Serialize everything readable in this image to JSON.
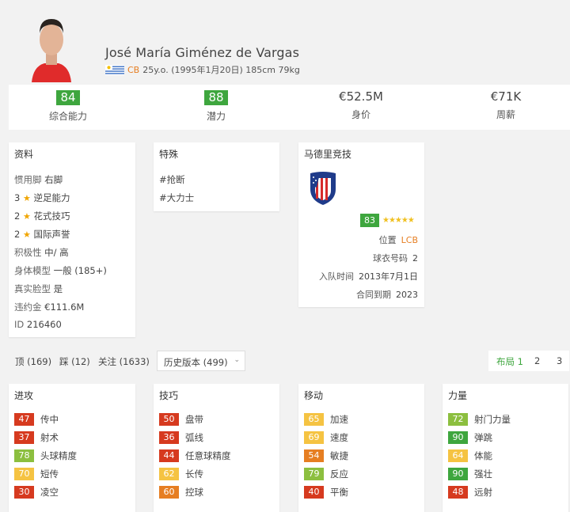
{
  "player": {
    "name": "José María Giménez de Vargas",
    "position": "CB",
    "details": "25y.o. (1995年1月20日) 185cm 79kg"
  },
  "stats": [
    {
      "value": "84",
      "label": "综合能力",
      "badge": true
    },
    {
      "value": "88",
      "label": "潜力",
      "badge": true
    },
    {
      "value": "€52.5M",
      "label": "身价",
      "badge": false
    },
    {
      "value": "€71K",
      "label": "周薪",
      "badge": false
    }
  ],
  "profile": {
    "title": "资料",
    "foot_label": "惯用脚",
    "foot_value": "右脚",
    "weak_foot_num": "3",
    "weak_foot_label": "逆足能力",
    "skill_num": "2",
    "skill_label": "花式技巧",
    "rep_num": "2",
    "rep_label": "国际声誉",
    "work_label": "积极性",
    "work_value": "中/ 高",
    "body_label": "身体模型",
    "body_value": "一般 (185+)",
    "real_label": "真实脸型",
    "real_value": "是",
    "release_label": "违约金",
    "release_value": "€111.6M",
    "id_label": "ID",
    "id_value": "216460"
  },
  "traits": {
    "title": "特殊",
    "items": [
      "#抢断",
      "#大力士"
    ]
  },
  "club": {
    "title": "马德里竞技",
    "rating": "83",
    "stars": "★★★★★",
    "position_label": "位置",
    "position_value": "LCB",
    "jersey_label": "球衣号码",
    "jersey_value": "2",
    "joined_label": "入队时间",
    "joined_value": "2013年7月1日",
    "contract_label": "合同到期",
    "contract_value": "2023"
  },
  "tabs": {
    "likes": "顶 (169)",
    "dislikes": "踩 (12)",
    "follow": "关注 (1633)",
    "history": "历史版本 (499)",
    "layout_label": "布局 1",
    "layout_2": "2",
    "layout_3": "3"
  },
  "attributes": [
    {
      "title": "进攻",
      "items": [
        {
          "v": "47",
          "n": "传中",
          "c": "#d63a1f"
        },
        {
          "v": "37",
          "n": "射术",
          "c": "#d63a1f"
        },
        {
          "v": "78",
          "n": "头球精度",
          "c": "#8cbf3f"
        },
        {
          "v": "70",
          "n": "短传",
          "c": "#f5c342"
        },
        {
          "v": "30",
          "n": "凌空",
          "c": "#d63a1f"
        }
      ]
    },
    {
      "title": "技巧",
      "items": [
        {
          "v": "50",
          "n": "盘带",
          "c": "#d63a1f"
        },
        {
          "v": "36",
          "n": "弧线",
          "c": "#d63a1f"
        },
        {
          "v": "44",
          "n": "任意球精度",
          "c": "#d63a1f"
        },
        {
          "v": "62",
          "n": "长传",
          "c": "#f5c342"
        },
        {
          "v": "60",
          "n": "控球",
          "c": "#e67e22"
        }
      ]
    },
    {
      "title": "移动",
      "items": [
        {
          "v": "65",
          "n": "加速",
          "c": "#f5c342"
        },
        {
          "v": "69",
          "n": "速度",
          "c": "#f5c342"
        },
        {
          "v": "54",
          "n": "敏捷",
          "c": "#e67e22"
        },
        {
          "v": "79",
          "n": "反应",
          "c": "#8cbf3f"
        },
        {
          "v": "40",
          "n": "平衡",
          "c": "#d63a1f"
        }
      ]
    },
    {
      "title": "力量",
      "items": [
        {
          "v": "72",
          "n": "射门力量",
          "c": "#8cbf3f"
        },
        {
          "v": "90",
          "n": "弹跳",
          "c": "#3ea63e"
        },
        {
          "v": "64",
          "n": "体能",
          "c": "#f5c342"
        },
        {
          "v": "90",
          "n": "强壮",
          "c": "#3ea63e"
        },
        {
          "v": "48",
          "n": "远射",
          "c": "#d63a1f"
        }
      ]
    }
  ]
}
